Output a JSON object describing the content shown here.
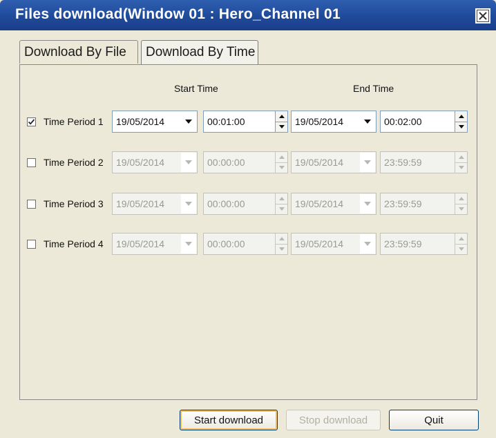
{
  "window": {
    "title": "Files download(Window 01 : Hero_Channel  01"
  },
  "tabs": [
    {
      "label": "Download By File",
      "active": false
    },
    {
      "label": "Download By Time",
      "active": true
    }
  ],
  "columns": {
    "start": "Start Time",
    "end": "End Time"
  },
  "periods": [
    {
      "label": "Time Period 1",
      "checked": true,
      "enabled": true,
      "start_date": "19/05/2014",
      "start_time": "00:01:00",
      "end_date": "19/05/2014",
      "end_time": "00:02:00"
    },
    {
      "label": "Time Period 2",
      "checked": false,
      "enabled": false,
      "start_date": "19/05/2014",
      "start_time": "00:00:00",
      "end_date": "19/05/2014",
      "end_time": "23:59:59"
    },
    {
      "label": "Time Period 3",
      "checked": false,
      "enabled": false,
      "start_date": "19/05/2014",
      "start_time": "00:00:00",
      "end_date": "19/05/2014",
      "end_time": "23:59:59"
    },
    {
      "label": "Time Period 4",
      "checked": false,
      "enabled": false,
      "start_date": "19/05/2014",
      "start_time": "00:00:00",
      "end_date": "19/05/2014",
      "end_time": "23:59:59"
    }
  ],
  "buttons": {
    "start": "Start download",
    "stop": "Stop download",
    "quit": "Quit"
  },
  "colors": {
    "titlebar": "#1f4a9a",
    "window_bg": "#ece9d8",
    "button_border": "#003c74",
    "default_button_ring": "#f5c05a"
  },
  "icons": {
    "close": "close-icon",
    "checkbox": "checkmark-icon",
    "dropdown": "chevron-down-icon",
    "spin_up": "spin-up-icon",
    "spin_down": "spin-down-icon"
  }
}
